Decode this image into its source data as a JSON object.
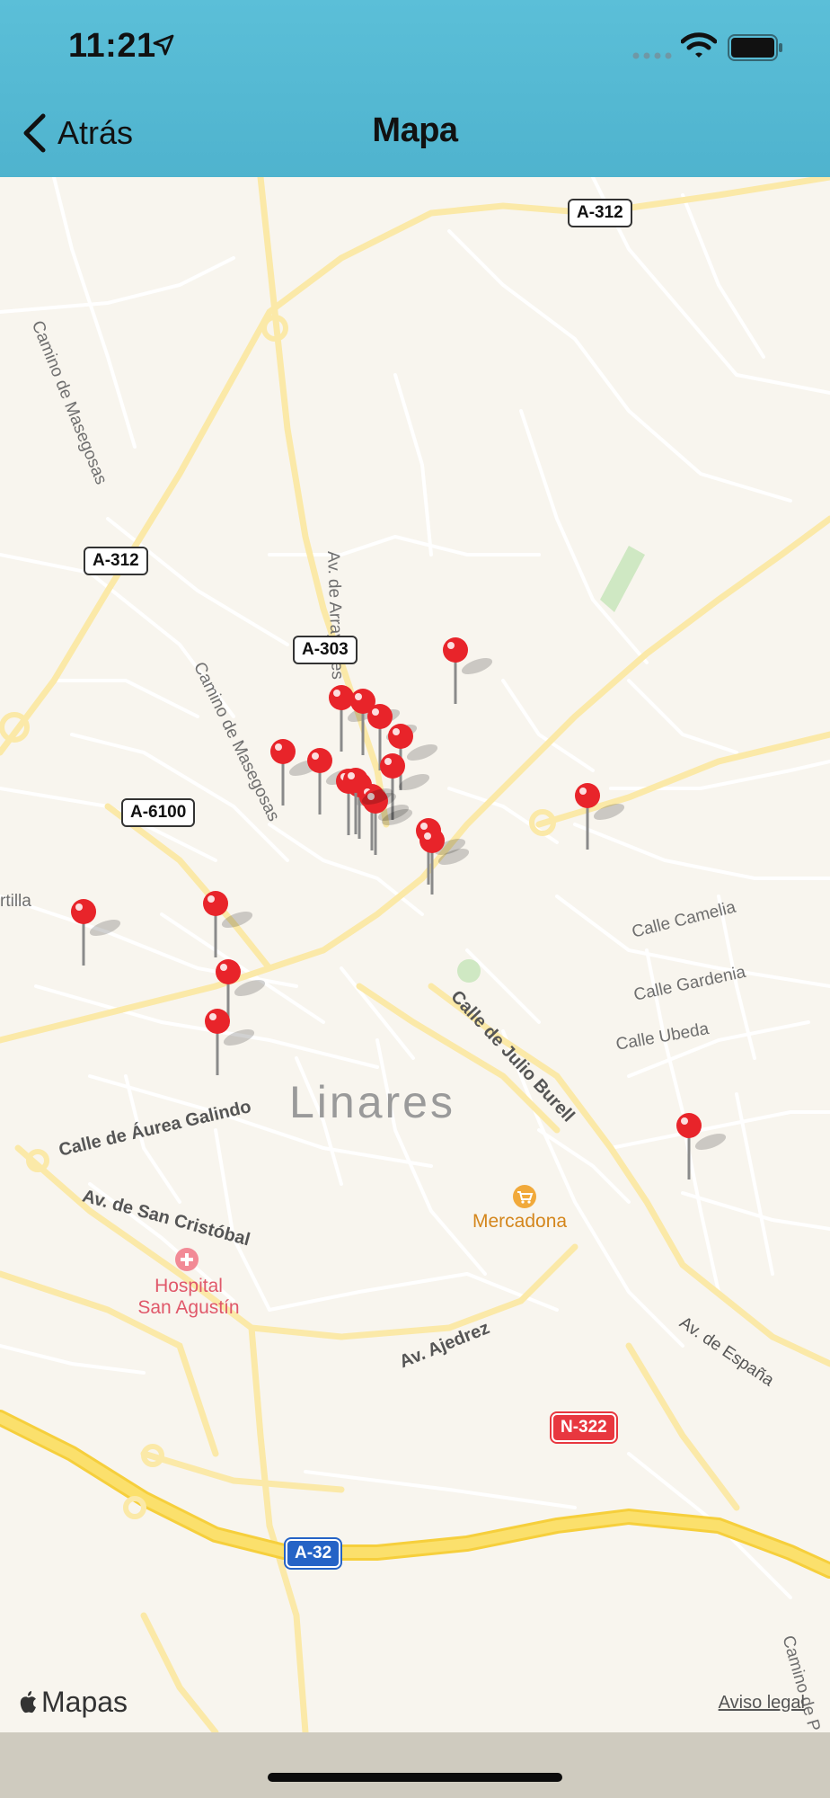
{
  "status_bar": {
    "time": "11:21"
  },
  "nav": {
    "back_label": "Atrás",
    "title": "Mapa"
  },
  "map": {
    "road_shields": [
      {
        "label": "A-312",
        "style": "white"
      },
      {
        "label": "A-312",
        "style": "white"
      },
      {
        "label": "A-303",
        "style": "white"
      },
      {
        "label": "A-6100",
        "style": "white"
      },
      {
        "label": "N-322",
        "style": "red"
      },
      {
        "label": "A-32",
        "style": "blue"
      }
    ],
    "streets": [
      "Camino de Masegosas",
      "Camino de Masegosas",
      "Av. de Arrayanes",
      "rtilla",
      "Calle Camelia",
      "Calle Gardenia",
      "Calle Ubeda",
      "Calle de Julio Burell",
      "Calle de Áurea Galindo",
      "Av. de San Cristóbal",
      "Av. Ajedrez",
      "Av. de España",
      "Camino de P"
    ],
    "city": "Linares",
    "pois": {
      "supermarket": "Mercadona",
      "hospital_line1": "Hospital",
      "hospital_line2": "San Agustín"
    },
    "pin_count": 21,
    "brand": "Mapas",
    "legal": "Aviso legal"
  },
  "colors": {
    "nav_bar": "#55b9d3",
    "pin": "#e8242a",
    "major_road": "#f9da5b",
    "secondary_road": "#fbe9a8",
    "street": "#ffffff",
    "land": "#f8f5ee"
  }
}
